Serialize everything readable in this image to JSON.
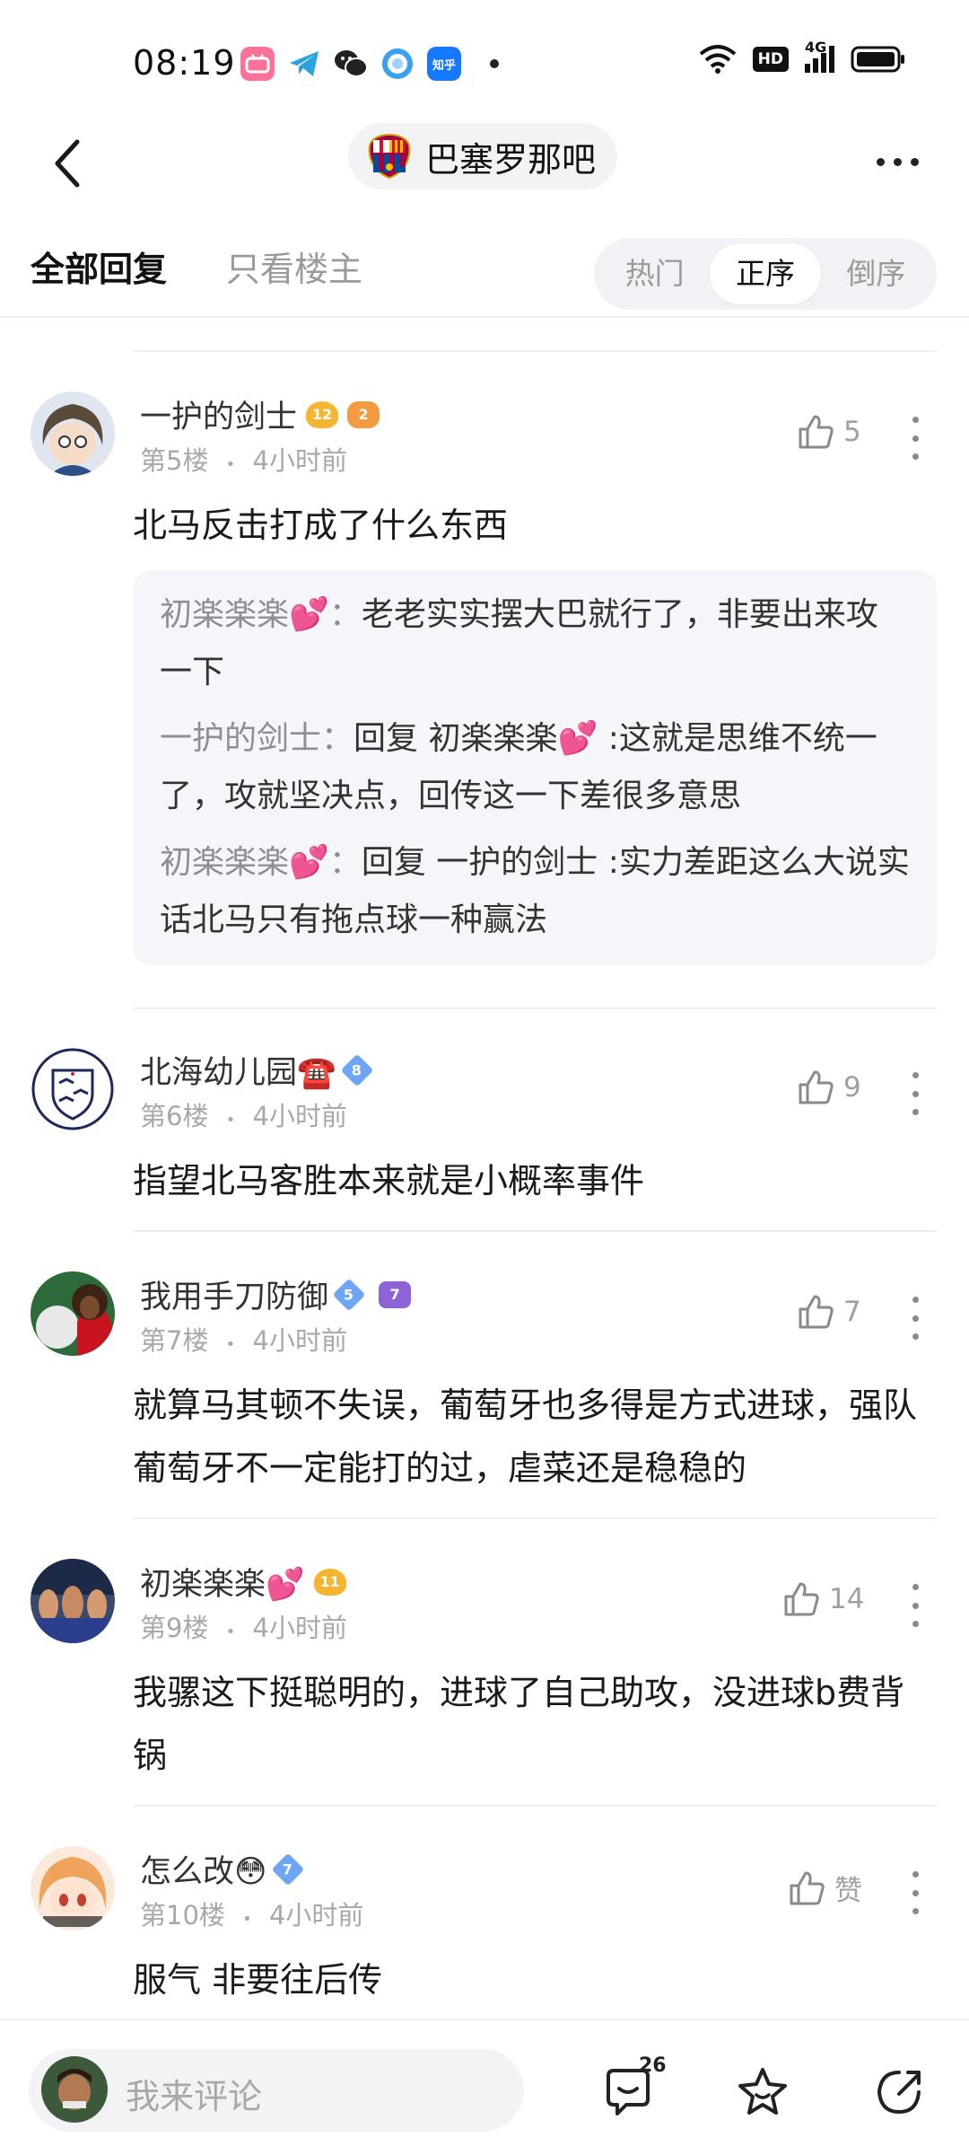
{
  "status_bar": {
    "time": "08:19",
    "app_icons": [
      "bilibili-icon",
      "telegram-icon",
      "wechat-icon",
      "browser-icon",
      "zhihu-icon"
    ],
    "zhihu_label": "知乎",
    "hd": "HD",
    "network": "4G"
  },
  "nav": {
    "forum_name": "巴塞罗那吧"
  },
  "filters": {
    "all_replies": "全部回复",
    "only_owner": "只看楼主",
    "sort_options": [
      "热门",
      "正序",
      "倒序"
    ],
    "active_sort": "正序"
  },
  "comments": [
    {
      "username": "一护的剑士",
      "badges": [
        "12",
        "2"
      ],
      "floor": "第5楼",
      "time": "4小时前",
      "likes": "5",
      "content": "北马反击打成了什么东西",
      "replies": [
        {
          "who": "初楽楽楽💕：",
          "text": "老老实实摆大巴就行了，非要出来攻一下"
        },
        {
          "who": "一护的剑士：",
          "text": "回复 初楽楽楽💕 :这就是思维不统一了，攻就坚决点，回传这一下差很多意思"
        },
        {
          "who": "初楽楽楽💕：",
          "text": "回复 一护的剑士 :实力差距这么大说实话北马只有拖点球一种赢法"
        }
      ]
    },
    {
      "username": "北海幼儿园☎️",
      "badges": [
        "8"
      ],
      "floor": "第6楼",
      "time": "4小时前",
      "likes": "9",
      "content": "指望北马客胜本来就是小概率事件"
    },
    {
      "username": "我用手刀防御",
      "badges": [
        "5",
        "7"
      ],
      "floor": "第7楼",
      "time": "4小时前",
      "likes": "7",
      "content": "就算马其顿不失误，葡萄牙也多得是方式进球，强队葡萄牙不一定能打的过，虐菜还是稳稳的"
    },
    {
      "username": "初楽楽楽💕",
      "badges": [
        "11"
      ],
      "floor": "第9楼",
      "time": "4小时前",
      "likes": "14",
      "content": "我骡这下挺聪明的，进球了自己助攻，没进球b费背锅"
    },
    {
      "username": "怎么改😳",
      "badges": [
        "7"
      ],
      "floor": "第10楼",
      "time": "4小时前",
      "likes": "赞",
      "content": "服气 非要往后传"
    }
  ],
  "meta_separator": "•",
  "bottom_bar": {
    "placeholder": "我来评论",
    "comment_count": "26"
  }
}
